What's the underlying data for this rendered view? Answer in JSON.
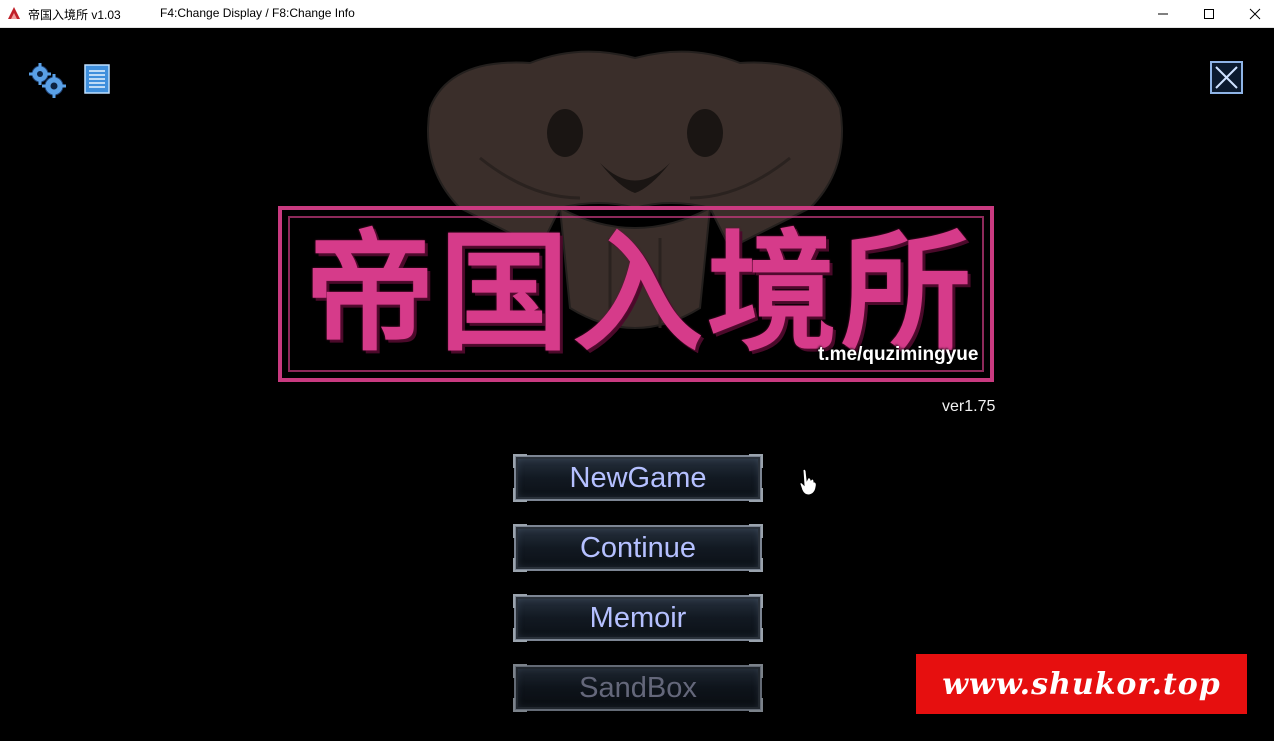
{
  "window": {
    "title": "帝国入境所 v1.03",
    "hint": "F4:Change Display / F8:Change Info",
    "controls": [
      "minimize-icon",
      "maximize-icon",
      "close-icon"
    ]
  },
  "toolbar": {
    "icons": [
      "gear-icon",
      "document-icon",
      "exit-icon"
    ]
  },
  "logo": {
    "title": "帝国入境所",
    "url": "t.me/quzimingyue",
    "color": "#d63b8a"
  },
  "version": "ver1.75",
  "menu": {
    "items": [
      {
        "label": "NewGame",
        "enabled": true
      },
      {
        "label": "Continue",
        "enabled": true
      },
      {
        "label": "Memoir",
        "enabled": true
      },
      {
        "label": "SandBox",
        "enabled": false
      }
    ]
  },
  "watermark": {
    "text": "www.shukor.top",
    "background": "#e60f0f"
  }
}
